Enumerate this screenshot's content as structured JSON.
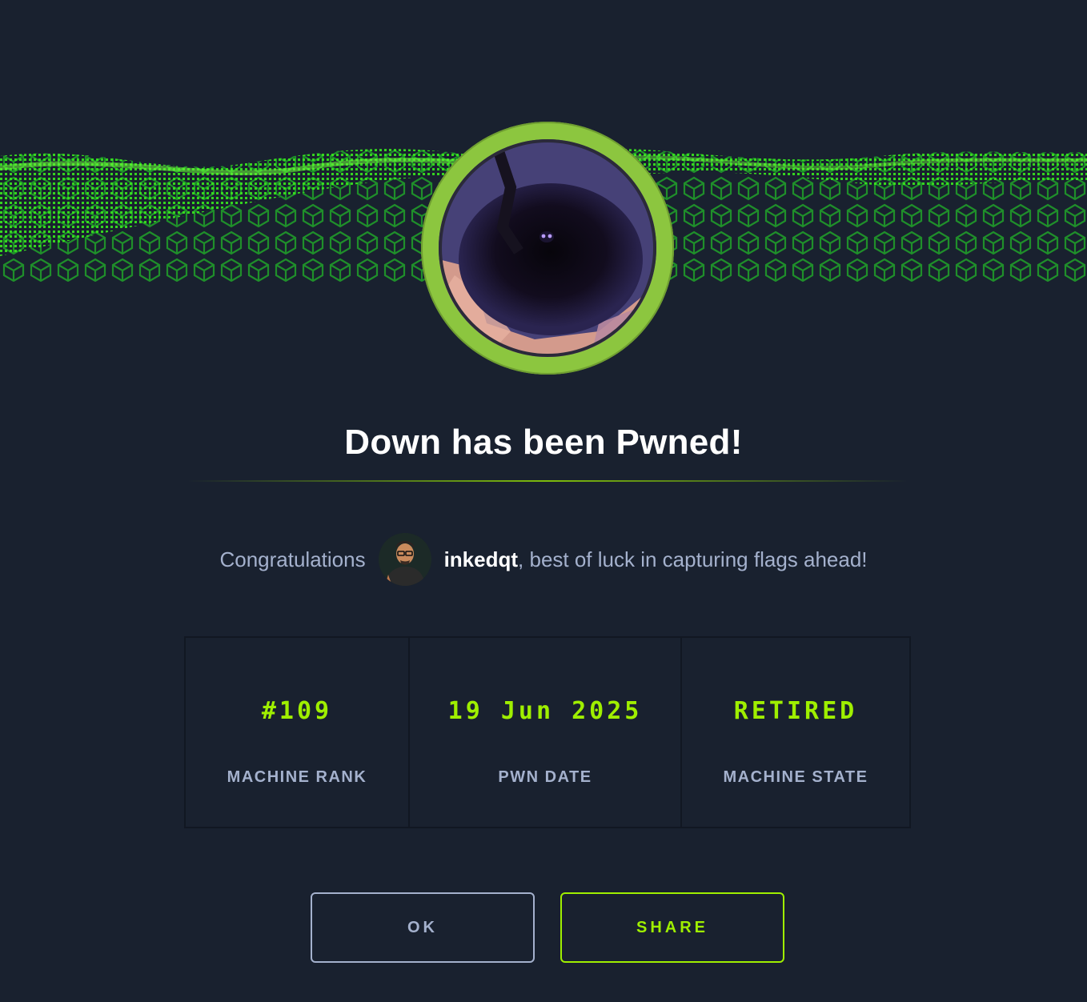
{
  "header": {
    "title": "Down has been Pwned!"
  },
  "congrats": {
    "prefix": "Congratulations",
    "username": "inkedqt",
    "suffix": ", best of luck in capturing flags ahead!"
  },
  "stats": [
    {
      "value": "#109",
      "label": "MACHINE RANK"
    },
    {
      "value": "19 Jun 2025",
      "label": "PWN DATE"
    },
    {
      "value": "RETIRED",
      "label": "MACHINE STATE"
    }
  ],
  "buttons": {
    "ok_label": "OK",
    "share_label": "SHARE"
  },
  "colors": {
    "background": "#19212f",
    "accent": "#9fef00",
    "avatar_ring": "#8cc63f",
    "muted_text": "#a4b1cd"
  }
}
